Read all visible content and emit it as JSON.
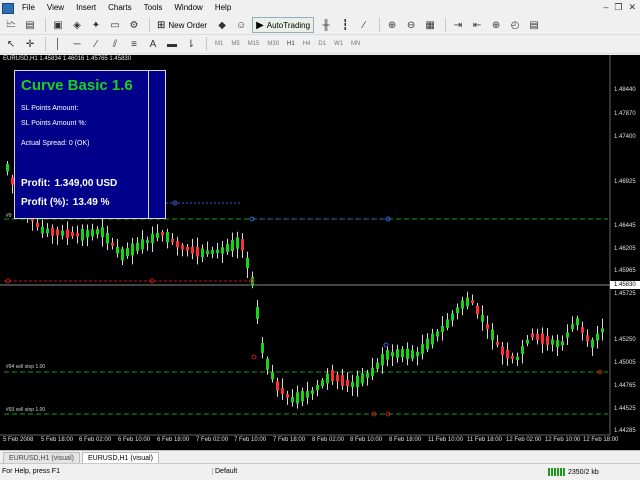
{
  "menu": {
    "items": [
      "File",
      "View",
      "Insert",
      "Charts",
      "Tools",
      "Window",
      "Help"
    ]
  },
  "window_controls": {
    "minimize": "–",
    "restore": "❐",
    "close": "✕"
  },
  "toolbar": {
    "new_order_label": "New Order",
    "autotrading_label": "AutoTrading"
  },
  "timeframes": [
    "M1",
    "M5",
    "M15",
    "M30",
    "H1",
    "H4",
    "D1",
    "W1",
    "MN"
  ],
  "active_timeframe": "H1",
  "chart": {
    "header": "EURUSD,H1  1.45834 1.46016 1.45765 1.45830",
    "current_price": "1.45830",
    "price_levels": [
      "1.48440",
      "1.47870",
      "1.47400",
      "1.46925",
      "1.46445",
      "1.46205",
      "1.45965",
      "1.45725",
      "1.45250",
      "1.45005",
      "1.44765",
      "1.44525",
      "1.44285"
    ],
    "time_labels": [
      "5 Feb 2008",
      "5 Feb 18:00",
      "6 Feb 02:00",
      "6 Feb 10:00",
      "6 Feb 18:00",
      "7 Feb 02:00",
      "7 Feb 10:00",
      "7 Feb 18:00",
      "8 Feb 02:00",
      "8 Feb 10:00",
      "8 Feb 18:00",
      "11 Feb 10:00",
      "11 Feb 18:00",
      "12 Feb 02:00",
      "12 Feb 10:00",
      "12 Feb 18:00"
    ],
    "order_labels": [
      "#94 sell stop 1.00",
      "#93 sell stop 1.00"
    ],
    "order_label_top": "#9",
    "colors": {
      "up_candle": "#19d319",
      "down_candle": "#ff3030",
      "order_line": "#1a9a1a",
      "sl_line": "#c01818",
      "background": "#000000"
    }
  },
  "ea_panel": {
    "title": "Curve Basic 1.6",
    "sl_points_label": "SL Points Amount:",
    "sl_points_pct_label": "SL Points Amount %:",
    "spread_label": "Actual Spread: 0 (OK)",
    "profit_label": "Profit:",
    "profit_value": "1.349,00 USD",
    "profit_pct_label": "Profit (%):",
    "profit_pct_value": "13.49 %"
  },
  "tabs": [
    "EURUSD,H1 (visual)",
    "EURUSD,H1 (visual)"
  ],
  "active_tab": 1,
  "status": {
    "help": "For Help, press F1",
    "profile": "Default",
    "traffic": "2350/2 kb"
  }
}
